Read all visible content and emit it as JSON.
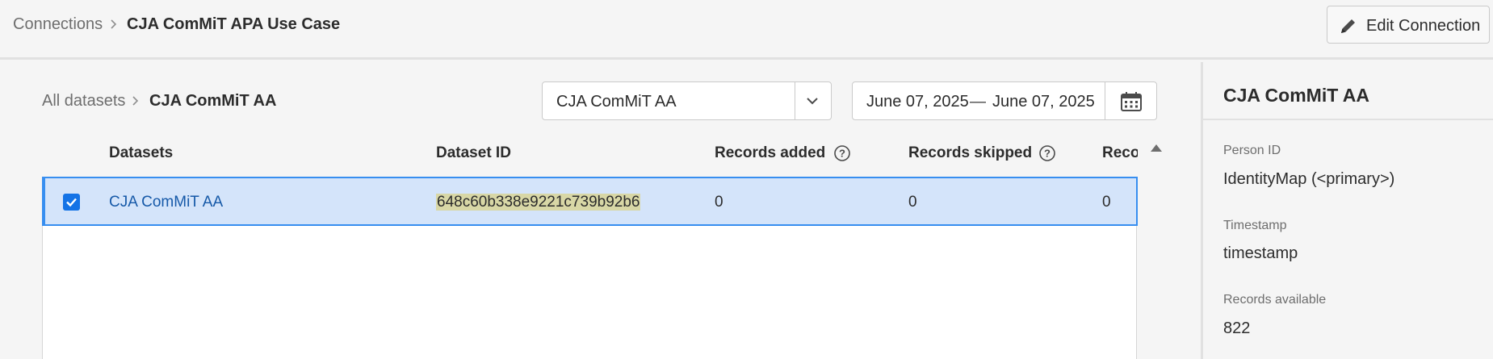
{
  "breadcrumb": {
    "root": "Connections",
    "current": "CJA ComMiT APA Use Case"
  },
  "header": {
    "edit_button_label": "Edit Connection"
  },
  "sub_breadcrumb": {
    "root": "All datasets",
    "current": "CJA ComMiT AA"
  },
  "dataset_picker": {
    "selected": "CJA ComMiT AA"
  },
  "date_range": {
    "start": "June 07, 2025",
    "separator": "—",
    "end": "June 07, 2025"
  },
  "table": {
    "columns": [
      "Datasets",
      "Dataset ID",
      "Records added",
      "Records skipped",
      "Reco"
    ],
    "rows": [
      {
        "selected": true,
        "dataset": "CJA ComMiT AA",
        "dataset_id": "648c60b338e9221c739b92b6",
        "records_added": "0",
        "records_skipped": "0",
        "reco": "0"
      }
    ]
  },
  "side_panel": {
    "title": "CJA ComMiT AA",
    "person_id_label": "Person ID",
    "person_id_value": "IdentityMap (<primary>)",
    "timestamp_label": "Timestamp",
    "timestamp_value": "timestamp",
    "records_available_label": "Records available",
    "records_available_value": "822"
  },
  "colors": {
    "accent": "#1473e6",
    "selected_row": "#d4e4fa",
    "id_highlight": "#d8d7a6"
  },
  "icons": [
    "chevron-right-icon",
    "pencil-icon",
    "chevron-down-icon",
    "calendar-icon",
    "help-icon",
    "checkmark-icon",
    "scroll-up-icon"
  ]
}
